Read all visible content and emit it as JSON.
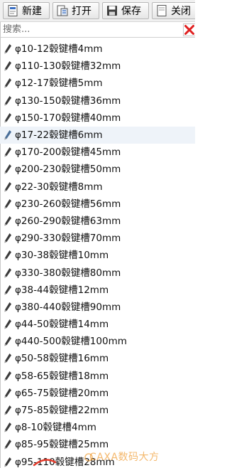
{
  "toolbar": {
    "new_label": "新建",
    "open_label": "打开",
    "save_label": "保存",
    "close_label": "关闭"
  },
  "search": {
    "placeholder": "搜索...",
    "value": ""
  },
  "list": {
    "selected_index": 5,
    "items": [
      "φ10-12毂键槽4mm",
      "φ110-130毂键槽32mm",
      "φ12-17毂键槽5mm",
      "φ130-150毂键槽36mm",
      "φ150-170毂键槽40mm",
      "φ17-22毂键槽6mm",
      "φ170-200毂键槽45mm",
      "φ200-230毂键槽50mm",
      "φ22-30毂键槽8mm",
      "φ230-260毂键槽56mm",
      "φ260-290毂键槽63mm",
      "φ290-330毂键槽70mm",
      "φ30-38毂键槽10mm",
      "φ330-380毂键槽80mm",
      "φ38-44毂键槽12mm",
      "φ380-440毂键槽90mm",
      "φ44-50毂键槽14mm",
      "φ440-500毂键槽100mm",
      "φ50-58毂键槽16mm",
      "φ58-65毂键槽18mm",
      "φ65-75毂键槽20mm",
      "φ75-85毂键槽22mm",
      "φ8-10毂键槽4mm",
      "φ85-95毂键槽25mm",
      "φ95-110毂键槽28mm"
    ]
  },
  "watermark": {
    "text": "CAXA数码大方"
  },
  "colors": {
    "toolbar_bg": "#f0f0f0",
    "selected_row_bg": "#eef3f9",
    "clear_icon_red": "#e02020",
    "watermark": "#f0a03c"
  },
  "icons": {
    "new": "new-document-icon",
    "open": "open-folder-icon",
    "save": "save-disk-icon",
    "close": "close-document-icon",
    "clear": "clear-x-icon",
    "item": "pen-icon"
  }
}
